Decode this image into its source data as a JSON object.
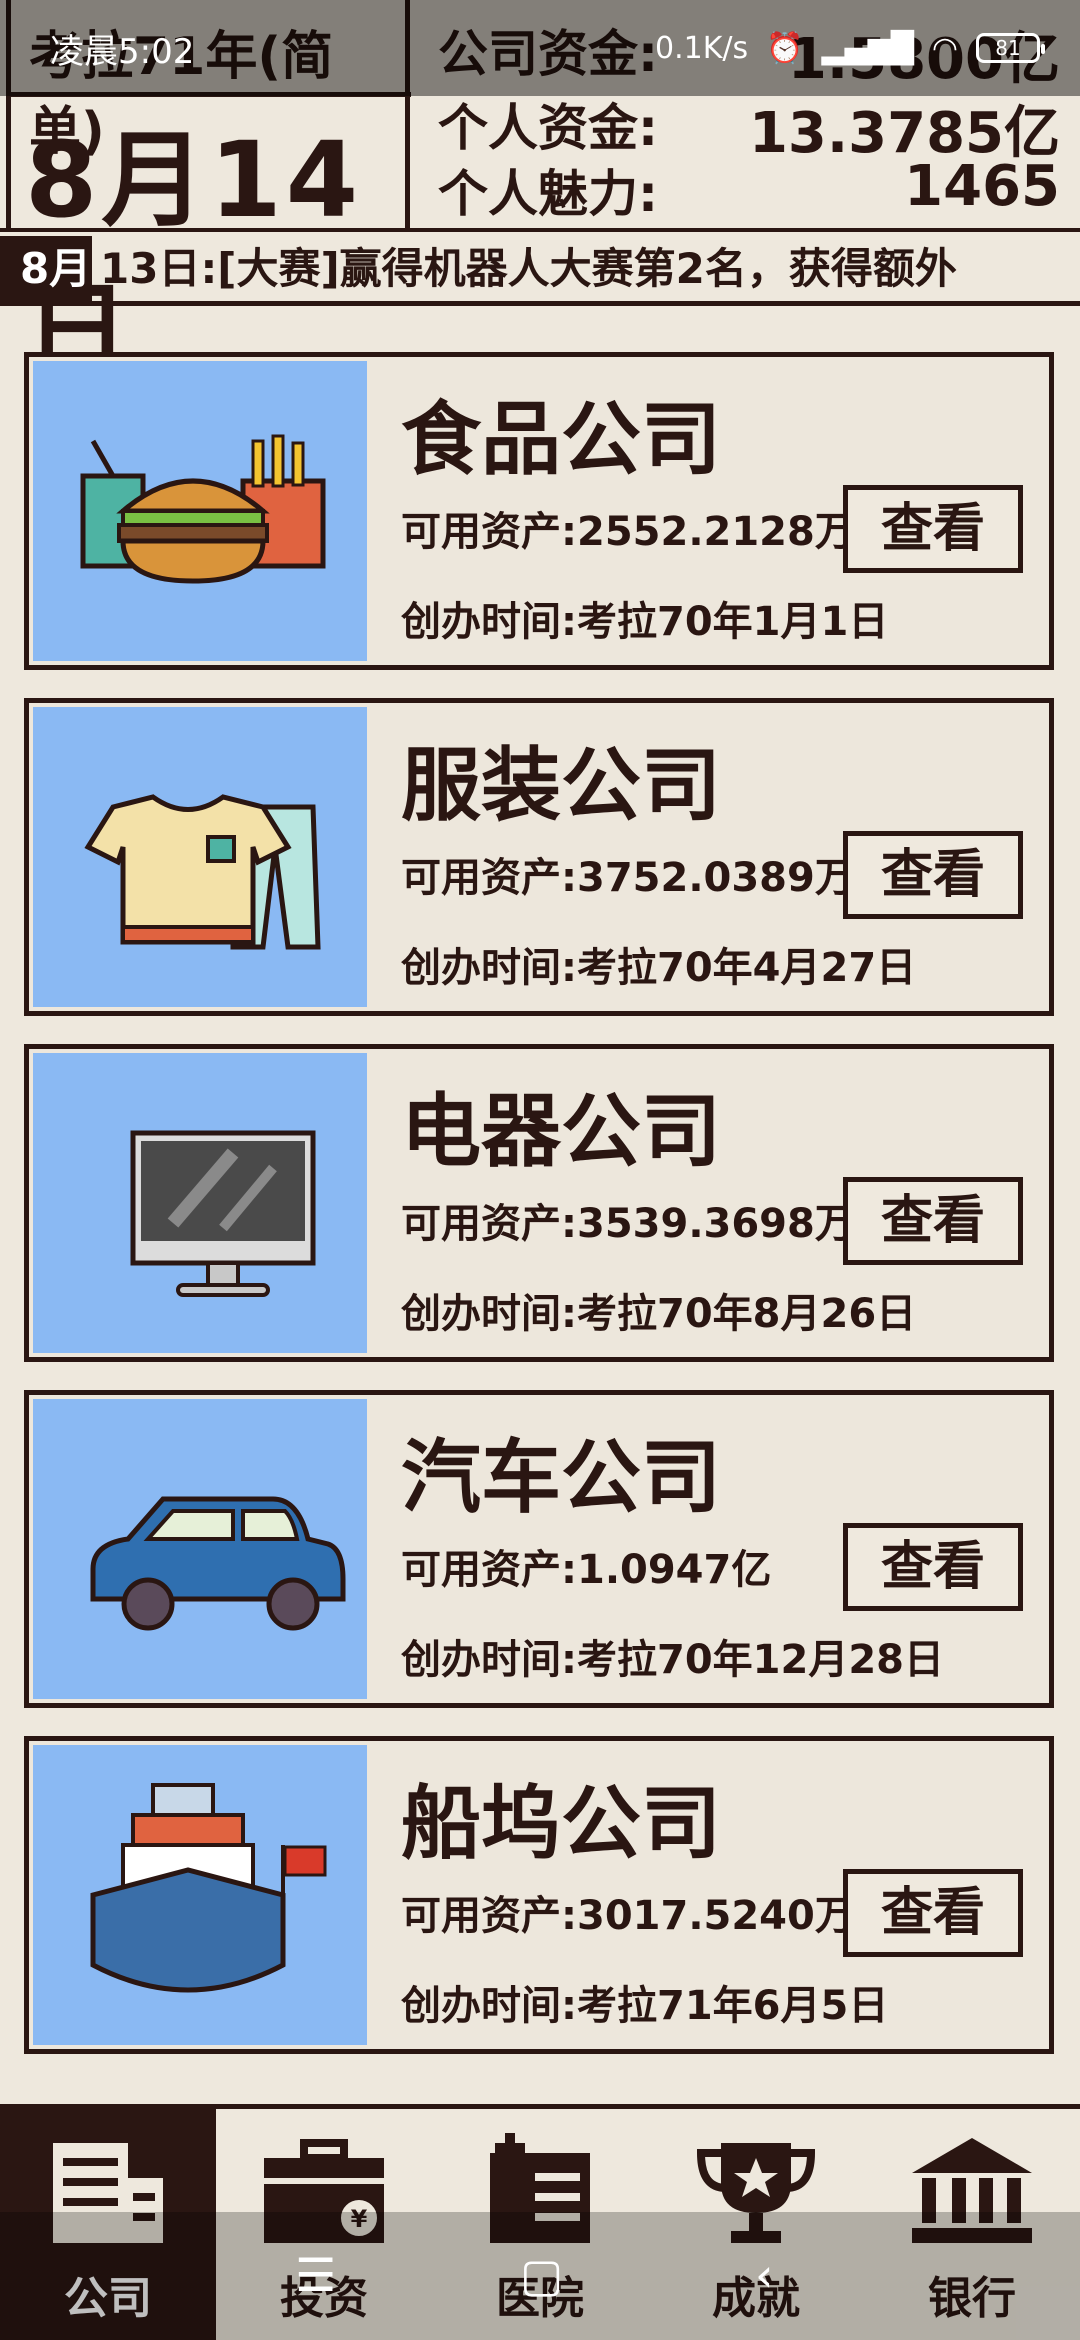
{
  "status_bar": {
    "time": "凌晨5:02",
    "speed": "0.1K/s",
    "battery": "81"
  },
  "header": {
    "year_label": "考拉71年(简单)",
    "date": "8月14日",
    "company_funds_label": "公司资金:",
    "company_funds_value": "1.5800亿",
    "personal_funds_label": "个人资金:",
    "personal_funds_value": "13.3785亿",
    "charm_label": "个人魅力:",
    "charm_value": "1465"
  },
  "ticker": {
    "tag": "8月",
    "text": "13日:[大赛]赢得机器人大赛第2名，获得额外"
  },
  "companies": [
    {
      "title": "食品公司",
      "assets": "可用资产:2552.2128万",
      "founded": "创办时间:考拉70年1月1日",
      "button": "查看",
      "icon": "food-icon"
    },
    {
      "title": "服装公司",
      "assets": "可用资产:3752.0389万",
      "founded": "创办时间:考拉70年4月27日",
      "button": "查看",
      "icon": "clothing-icon"
    },
    {
      "title": "电器公司",
      "assets": "可用资产:3539.3698万",
      "founded": "创办时间:考拉70年8月26日",
      "button": "查看",
      "icon": "monitor-icon"
    },
    {
      "title": "汽车公司",
      "assets": "可用资产:1.0947亿",
      "founded": "创办时间:考拉70年12月28日",
      "button": "查看",
      "icon": "car-icon"
    },
    {
      "title": "船坞公司",
      "assets": "可用资产:3017.5240万",
      "founded": "创办时间:考拉71年6月5日",
      "button": "查看",
      "icon": "ship-icon"
    }
  ],
  "nav": [
    {
      "label": "公司",
      "icon": "building-icon",
      "active": true
    },
    {
      "label": "投资",
      "icon": "briefcase-icon",
      "active": false
    },
    {
      "label": "医院",
      "icon": "hospital-icon",
      "active": false
    },
    {
      "label": "成就",
      "icon": "trophy-icon",
      "active": false
    },
    {
      "label": "银行",
      "icon": "bank-icon",
      "active": false
    }
  ],
  "colors": {
    "accent": "#2a1612",
    "background": "#eee8dd",
    "image_bg": "#8ab9f3"
  }
}
